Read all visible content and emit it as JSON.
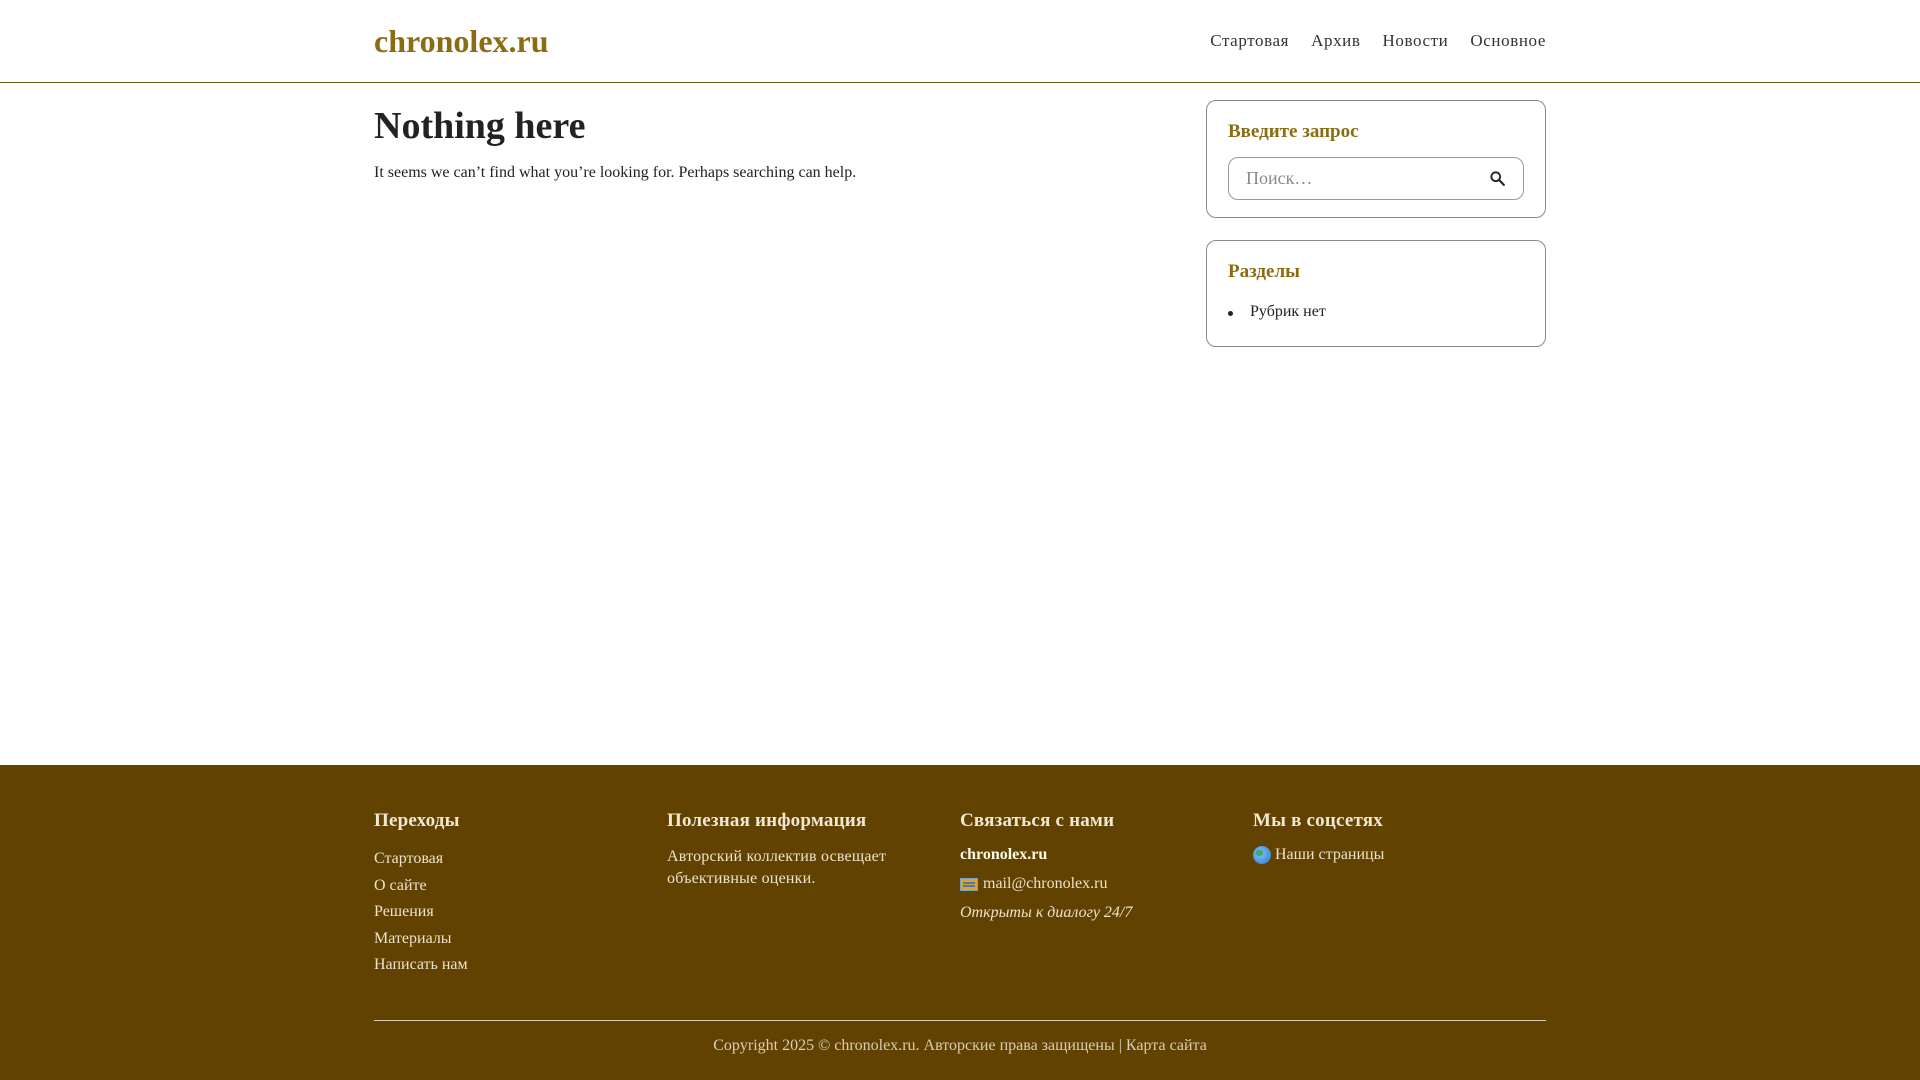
{
  "header": {
    "site_title": "chronolex.ru",
    "nav": [
      "Стартовая",
      "Архив",
      "Новости",
      "Основное"
    ]
  },
  "main": {
    "title": "Nothing here",
    "text": "It seems we can’t find what you’re looking for. Perhaps searching can help."
  },
  "sidebar": {
    "search_widget": {
      "title": "Введите запрос",
      "placeholder": "Поиск…",
      "icon": "search-icon"
    },
    "categories_widget": {
      "title": "Разделы",
      "items": [
        "Рубрик нет"
      ]
    }
  },
  "footer": {
    "col1": {
      "title": "Переходы",
      "links": [
        "Стартовая",
        "О сайте",
        "Решения",
        "Материалы",
        "Написать нам"
      ]
    },
    "col2": {
      "title": "Полезная информация",
      "text": "Авторский коллектив освещает объективные оценки."
    },
    "col3": {
      "title": "Связаться с нами",
      "brand": "chronolex.ru",
      "email": "mail@chronolex.ru",
      "email_icon": "mail-icon",
      "hours": "Открыты к диалогу 24/7"
    },
    "col4": {
      "title": "Мы в соцсетях",
      "link": "Наши страницы",
      "link_icon": "globe-icon"
    },
    "copyright": "Copyright 2025 © chronolex.ru. Авторские права защищены | Карта сайта"
  },
  "colors": {
    "accent": "#8a6d12",
    "footer_bg": "#614201",
    "header_border": "#6b5514"
  }
}
